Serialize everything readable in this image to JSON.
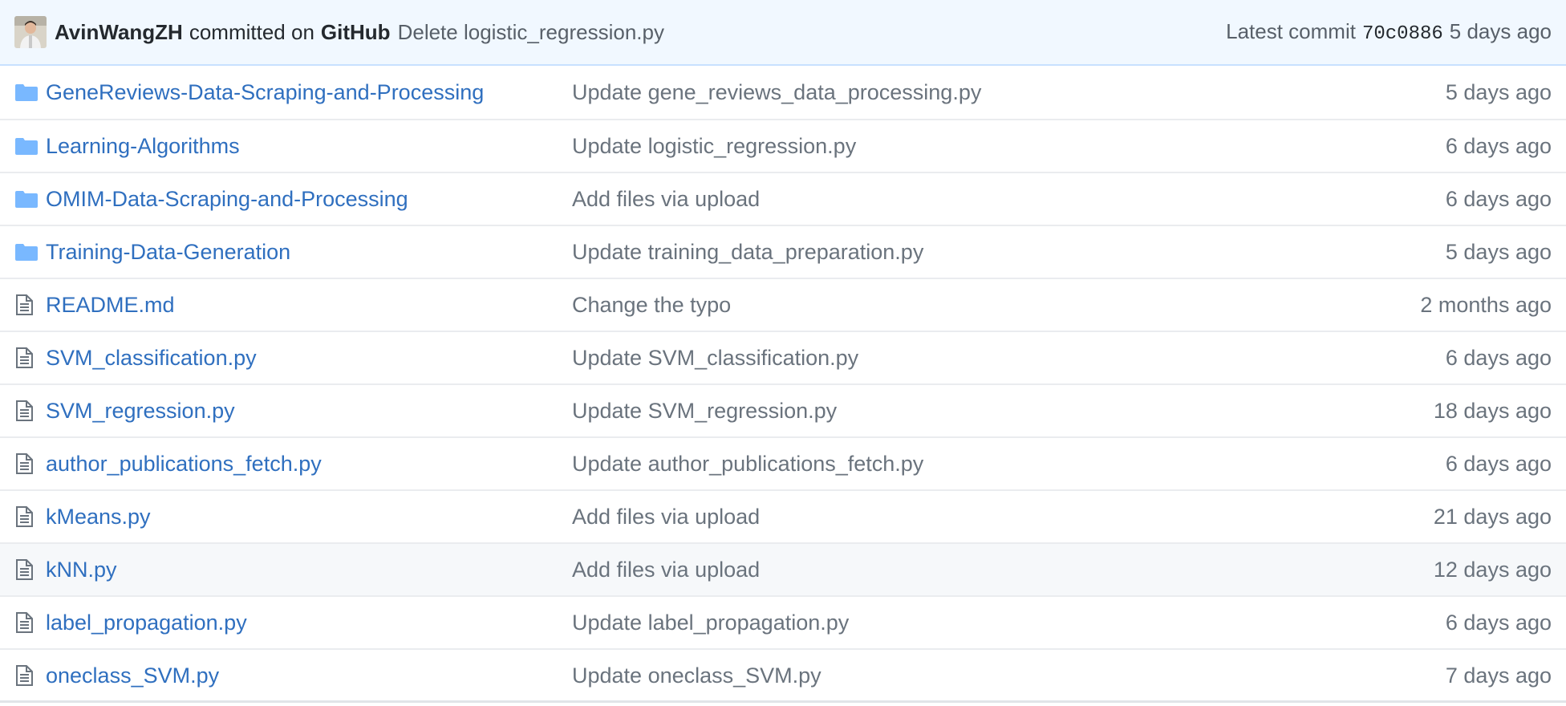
{
  "commit": {
    "author": "AvinWangZH",
    "committed_on": "committed on",
    "platform": "GitHub",
    "message": "Delete logistic_regression.py",
    "latest_label": "Latest commit",
    "sha": "70c0886",
    "age": "5 days ago"
  },
  "colors": {
    "link": "#2f6fbf",
    "folder_icon": "#79b8ff",
    "muted": "#6a737d",
    "commit_bar_bg": "#f1f8ff",
    "hover_row_bg": "#f6f8fa"
  },
  "files": [
    {
      "type": "folder",
      "icon": "folder-icon",
      "name": "GeneReviews-Data-Scraping-and-Processing",
      "message": "Update gene_reviews_data_processing.py",
      "age": "5 days ago"
    },
    {
      "type": "folder",
      "icon": "folder-icon",
      "name": "Learning-Algorithms",
      "message": "Update logistic_regression.py",
      "age": "6 days ago"
    },
    {
      "type": "folder",
      "icon": "folder-icon",
      "name": "OMIM-Data-Scraping-and-Processing",
      "message": "Add files via upload",
      "age": "6 days ago"
    },
    {
      "type": "folder",
      "icon": "folder-icon",
      "name": "Training-Data-Generation",
      "message": "Update training_data_preparation.py",
      "age": "5 days ago"
    },
    {
      "type": "file",
      "icon": "file-icon",
      "name": "README.md",
      "message": "Change the typo",
      "age": "2 months ago"
    },
    {
      "type": "file",
      "icon": "file-icon",
      "name": "SVM_classification.py",
      "message": "Update SVM_classification.py",
      "age": "6 days ago"
    },
    {
      "type": "file",
      "icon": "file-icon",
      "name": "SVM_regression.py",
      "message": "Update SVM_regression.py",
      "age": "18 days ago"
    },
    {
      "type": "file",
      "icon": "file-icon",
      "name": "author_publications_fetch.py",
      "message": "Update author_publications_fetch.py",
      "age": "6 days ago"
    },
    {
      "type": "file",
      "icon": "file-icon",
      "name": "kMeans.py",
      "message": "Add files via upload",
      "age": "21 days ago"
    },
    {
      "type": "file",
      "icon": "file-icon",
      "name": "kNN.py",
      "message": "Add files via upload",
      "age": "12 days ago",
      "hovered": true
    },
    {
      "type": "file",
      "icon": "file-icon",
      "name": "label_propagation.py",
      "message": "Update label_propagation.py",
      "age": "6 days ago"
    },
    {
      "type": "file",
      "icon": "file-icon",
      "name": "oneclass_SVM.py",
      "message": "Update oneclass_SVM.py",
      "age": "7 days ago"
    }
  ]
}
